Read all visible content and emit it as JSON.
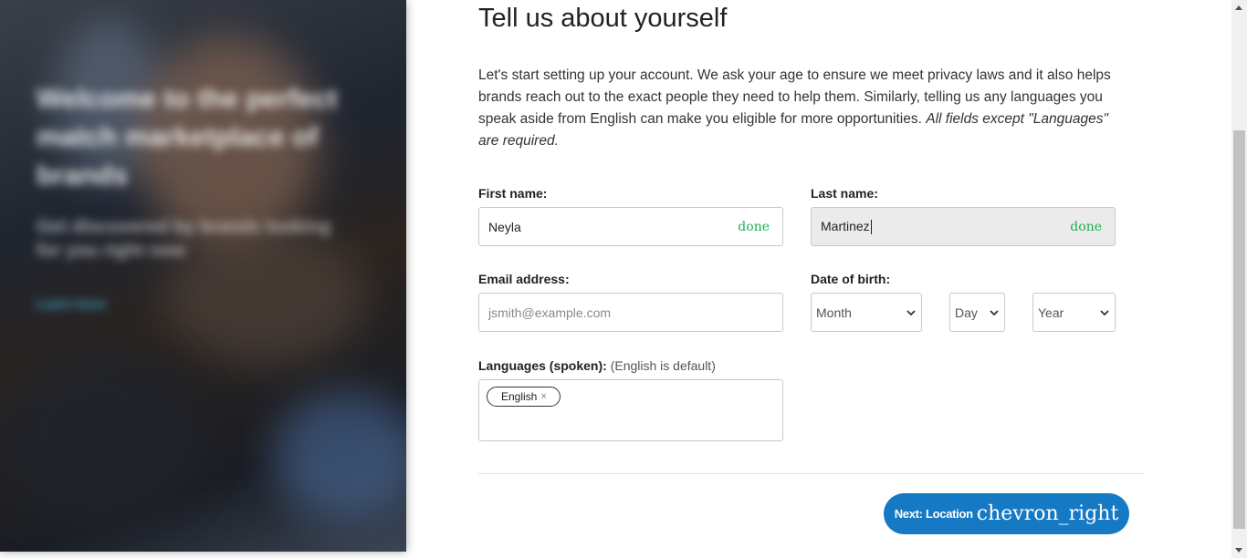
{
  "hero": {
    "headline": "Welcome to the perfect match marketplace of brands",
    "subtext": "Get discovered by brands looking for you right now",
    "link": "Learn more"
  },
  "form": {
    "title": "Tell us about yourself",
    "intro_text": "Let's start setting up your account. We ask your age to ensure we meet privacy laws and it also helps brands reach out to the exact people they need to help them. Similarly, telling us any languages you speak aside from English can make you eligible for more opportunities. ",
    "intro_emphasis": "All fields except \"Languages\" are required.",
    "first_name": {
      "label": "First name:",
      "value": "Neyla",
      "status": "done"
    },
    "last_name": {
      "label": "Last name:",
      "value": "Martinez",
      "status": "done"
    },
    "email": {
      "label": "Email address:",
      "placeholder": "jsmith@example.com",
      "value": ""
    },
    "dob": {
      "label": "Date of birth:",
      "month": "Month",
      "day": "Day",
      "year": "Year"
    },
    "languages": {
      "label": "Languages (spoken):",
      "hint": "(English is default)",
      "chips": [
        {
          "label": "English",
          "remove": "×"
        }
      ]
    },
    "next_button": {
      "label": "Next: Location",
      "icon": "chevron_right"
    }
  }
}
